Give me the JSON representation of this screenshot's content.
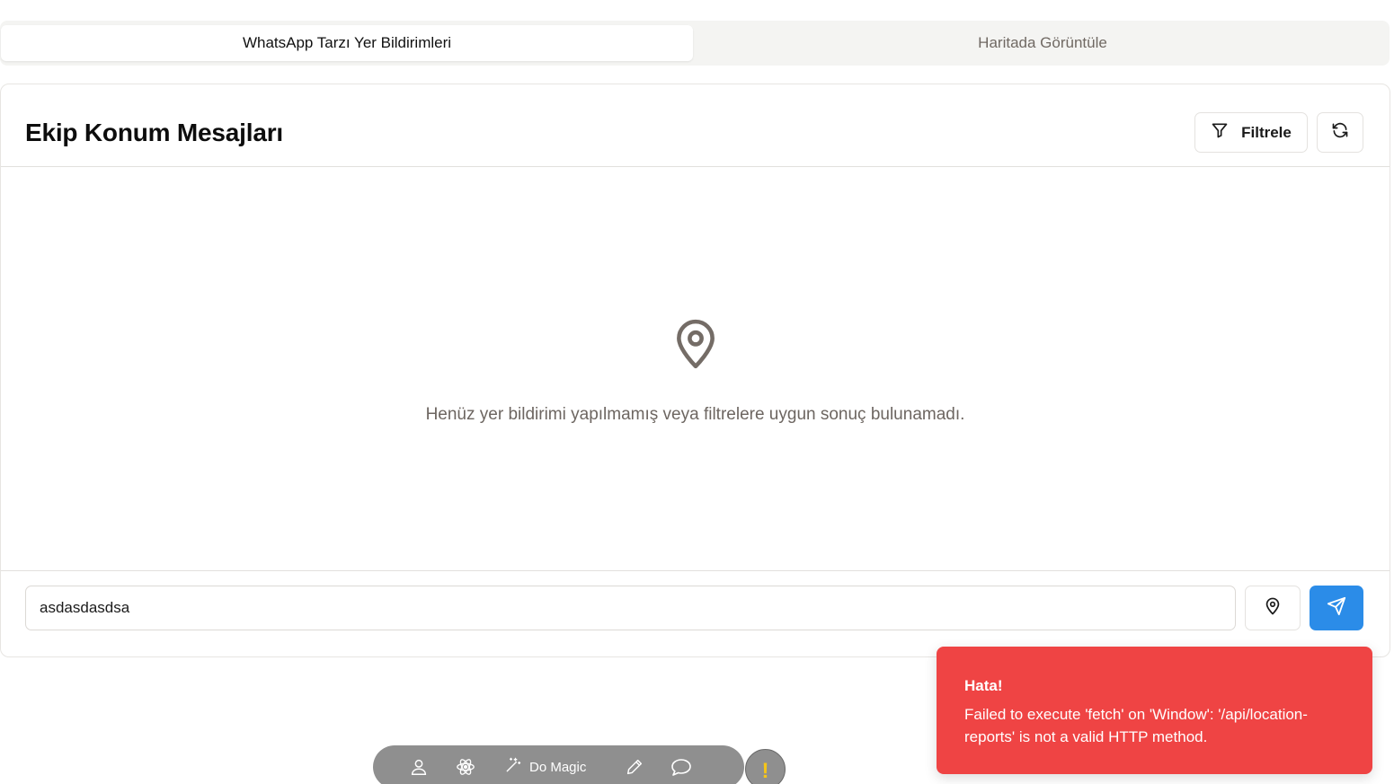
{
  "tabs": [
    {
      "label": "WhatsApp Tarzı Yer Bildirimleri",
      "active": true
    },
    {
      "label": "Haritada Görüntüle",
      "active": false
    }
  ],
  "header": {
    "title": "Ekip Konum Mesajları",
    "filter_label": "Filtrele",
    "filter_icon": "filter-icon",
    "refresh_icon": "refresh-icon"
  },
  "empty_state": {
    "icon": "map-pin-icon",
    "text": "Henüz yer bildirimi yapılmamış veya filtrelere uygun sonuç bulunamadı."
  },
  "composer": {
    "value": "asdasdasdsa",
    "location_icon": "map-pin-icon",
    "send_icon": "send-icon",
    "send_color": "#2b8ce8"
  },
  "toast": {
    "title": "Hata!",
    "message": "Failed to execute 'fetch' on 'Window': '/api/location-reports' is not a valid HTTP method.",
    "color": "#ef4444"
  },
  "toolbar": {
    "magic_label": "Do Magic",
    "icons": [
      "user-icon",
      "atom-icon",
      "magic-wand-icon",
      "pencil-icon",
      "chat-icon"
    ],
    "warning_glyph": "!"
  }
}
